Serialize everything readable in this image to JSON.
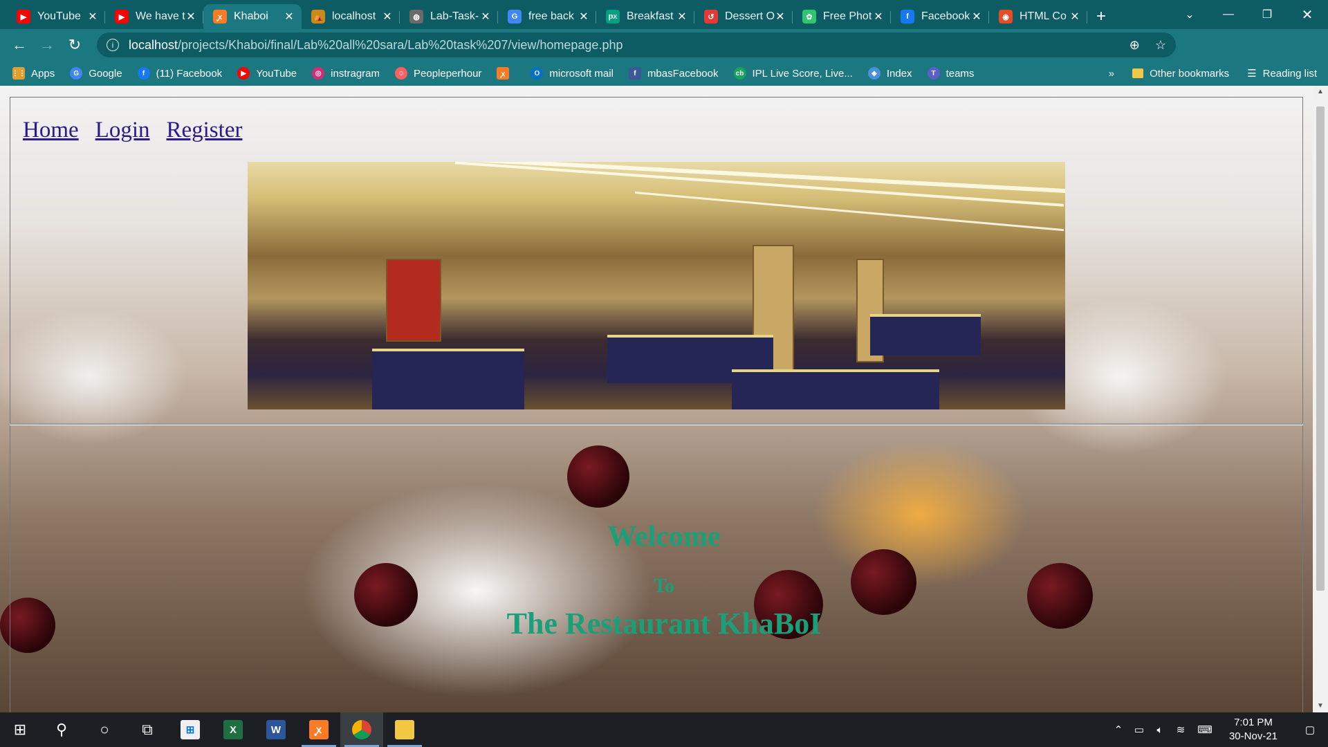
{
  "browser": {
    "tabs": [
      {
        "label": "YouTube",
        "icon": "youtube-icon",
        "color": "#ff0000",
        "glyph": "▶"
      },
      {
        "label": "We have t",
        "icon": "youtube-icon",
        "color": "#ff0000",
        "glyph": "▶"
      },
      {
        "label": "Khaboi",
        "icon": "xampp-icon",
        "color": "#fb7a24",
        "glyph": "ꭙ",
        "active": true
      },
      {
        "label": "localhost",
        "icon": "localhost-icon",
        "color": "#c98a1a",
        "glyph": "⛺"
      },
      {
        "label": "Lab-Task-",
        "icon": "globe-icon",
        "color": "#6a6a6a",
        "glyph": "◍"
      },
      {
        "label": "free back",
        "icon": "google-icon",
        "color": "#4285f4",
        "glyph": "G"
      },
      {
        "label": "Breakfast",
        "icon": "pexels-icon",
        "color": "#05a081",
        "glyph": "px"
      },
      {
        "label": "Dessert O",
        "icon": "dessert-icon",
        "color": "#e53935",
        "glyph": "↺"
      },
      {
        "label": "Free Phot",
        "icon": "pixabay-icon",
        "color": "#2ec66e",
        "glyph": "✿"
      },
      {
        "label": "Facebook",
        "icon": "facebook-icon",
        "color": "#1877f2",
        "glyph": "f"
      },
      {
        "label": "HTML Co",
        "icon": "html-icon",
        "color": "#e44d26",
        "glyph": "◉"
      }
    ],
    "address": {
      "host": "localhost",
      "path": "/projects/Khaboi/final/Lab%20all%20sara/Lab%20task%207/view/homepage.php"
    },
    "bookmarks": [
      {
        "label": "Apps",
        "icon": "apps-grid-icon",
        "color": "#e0a030",
        "glyph": "⋮⋮"
      },
      {
        "label": "Google",
        "icon": "google-icon",
        "color": "#4285f4",
        "glyph": "G"
      },
      {
        "label": "(11) Facebook",
        "icon": "facebook-icon",
        "color": "#1877f2",
        "glyph": "f"
      },
      {
        "label": "YouTube",
        "icon": "youtube-icon",
        "color": "#ff0000",
        "glyph": "▶"
      },
      {
        "label": "instragram",
        "icon": "instagram-icon",
        "color": "#d62976",
        "glyph": "◎"
      },
      {
        "label": "Peopleperhour",
        "icon": "peopleperhour-icon",
        "color": "#ff5f5f",
        "glyph": "☺"
      },
      {
        "label": "",
        "icon": "xampp-icon",
        "color": "#fb7a24",
        "glyph": "ꭙ"
      },
      {
        "label": "microsoft mail",
        "icon": "outlook-icon",
        "color": "#0072c6",
        "glyph": "O"
      },
      {
        "label": "mbasFacebook",
        "icon": "facebook-icon",
        "color": "#3b5998",
        "glyph": "f"
      },
      {
        "label": "IPL Live Score, Live...",
        "icon": "cricbuzz-icon",
        "color": "#19a35a",
        "glyph": "cb"
      },
      {
        "label": "Index",
        "icon": "index-icon",
        "color": "#4a90d9",
        "glyph": "◈"
      },
      {
        "label": "teams",
        "icon": "teams-icon",
        "color": "#5b5fc7",
        "glyph": "T"
      }
    ],
    "bookmarks_overflow": "»",
    "other_bookmarks": "Other bookmarks",
    "reading_list": "Reading list"
  },
  "page": {
    "nav": [
      {
        "label": "Home"
      },
      {
        "label": "Login"
      },
      {
        "label": "Register"
      }
    ],
    "welcome_line1": "Welcome",
    "welcome_line2": "To",
    "welcome_line3": "The Restaurant KhaBoI",
    "accent_color": "#1aa078"
  },
  "taskbar": {
    "time": "7:01 PM",
    "date": "30-Nov-21"
  }
}
